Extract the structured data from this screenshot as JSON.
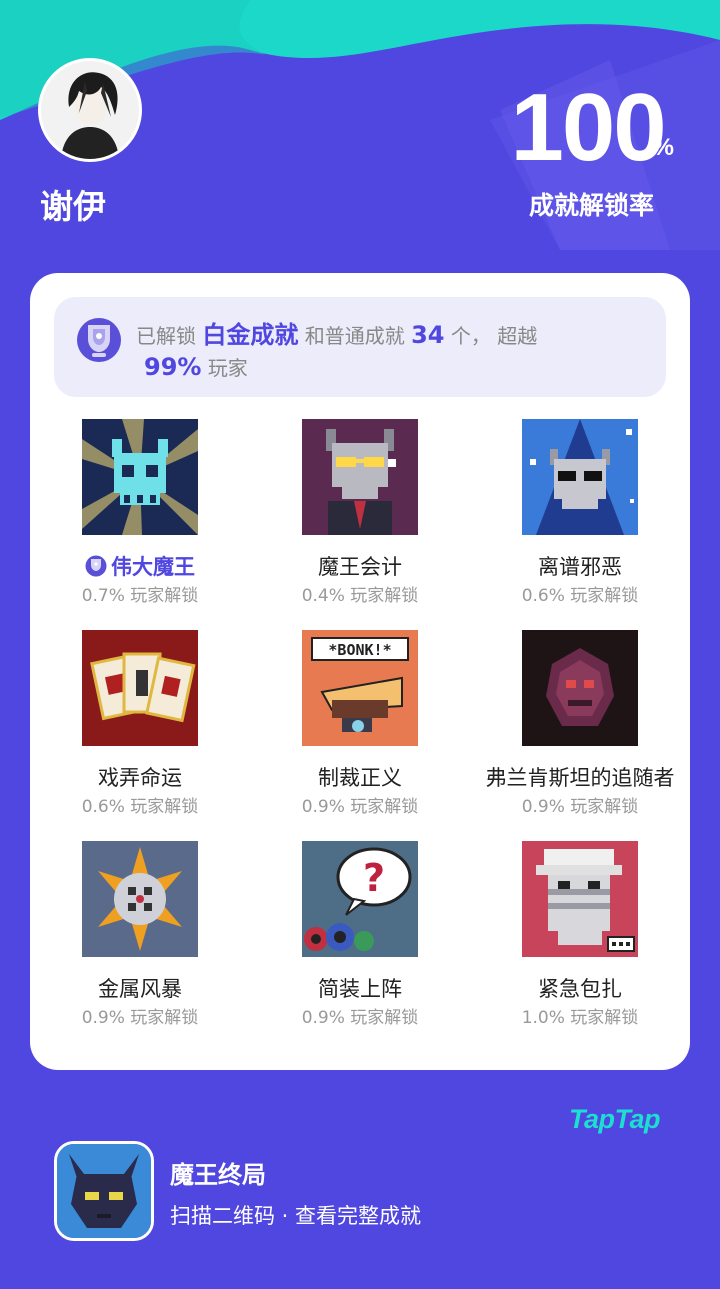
{
  "profile": {
    "username": "谢伊",
    "avatar_icon": "user-avatar"
  },
  "completion": {
    "value": "100",
    "unit": "%",
    "label": "成就解锁率"
  },
  "summary": {
    "prefix": "已解锁",
    "highlight_1": "白金成就",
    "middle": "和普通成就",
    "count": "34",
    "suffix": "个，  超越",
    "percent": "99%",
    "tail": "玩家",
    "icon": "trophy-icon"
  },
  "achievements": [
    {
      "name": "伟大魔王",
      "pct": "0.7% 玩家解锁",
      "platinum": true
    },
    {
      "name": "魔王会计",
      "pct": "0.4% 玩家解锁"
    },
    {
      "name": "离谱邪恶",
      "pct": "0.6% 玩家解锁"
    },
    {
      "name": "戏弄命运",
      "pct": "0.6% 玩家解锁"
    },
    {
      "name": "制裁正义",
      "pct": "0.9% 玩家解锁"
    },
    {
      "name": "弗兰肯斯坦的追随者",
      "pct": "0.9% 玩家解锁"
    },
    {
      "name": "金属风暴",
      "pct": "0.9% 玩家解锁"
    },
    {
      "name": "简装上阵",
      "pct": "0.9% 玩家解锁"
    },
    {
      "name": "紧急包扎",
      "pct": "1.0% 玩家解锁"
    }
  ],
  "tile_art": {
    "bonk_text": "*BONK!*",
    "question_mark": "?"
  },
  "brand": {
    "logo": "TapTap"
  },
  "game": {
    "title": "魔王终局",
    "subtitle": "扫描二维码 · 查看完整成就"
  },
  "colors": {
    "background": "#5046e0",
    "accent_teal": "#1be0d0",
    "highlight": "#5046e0",
    "card": "#ffffff"
  }
}
